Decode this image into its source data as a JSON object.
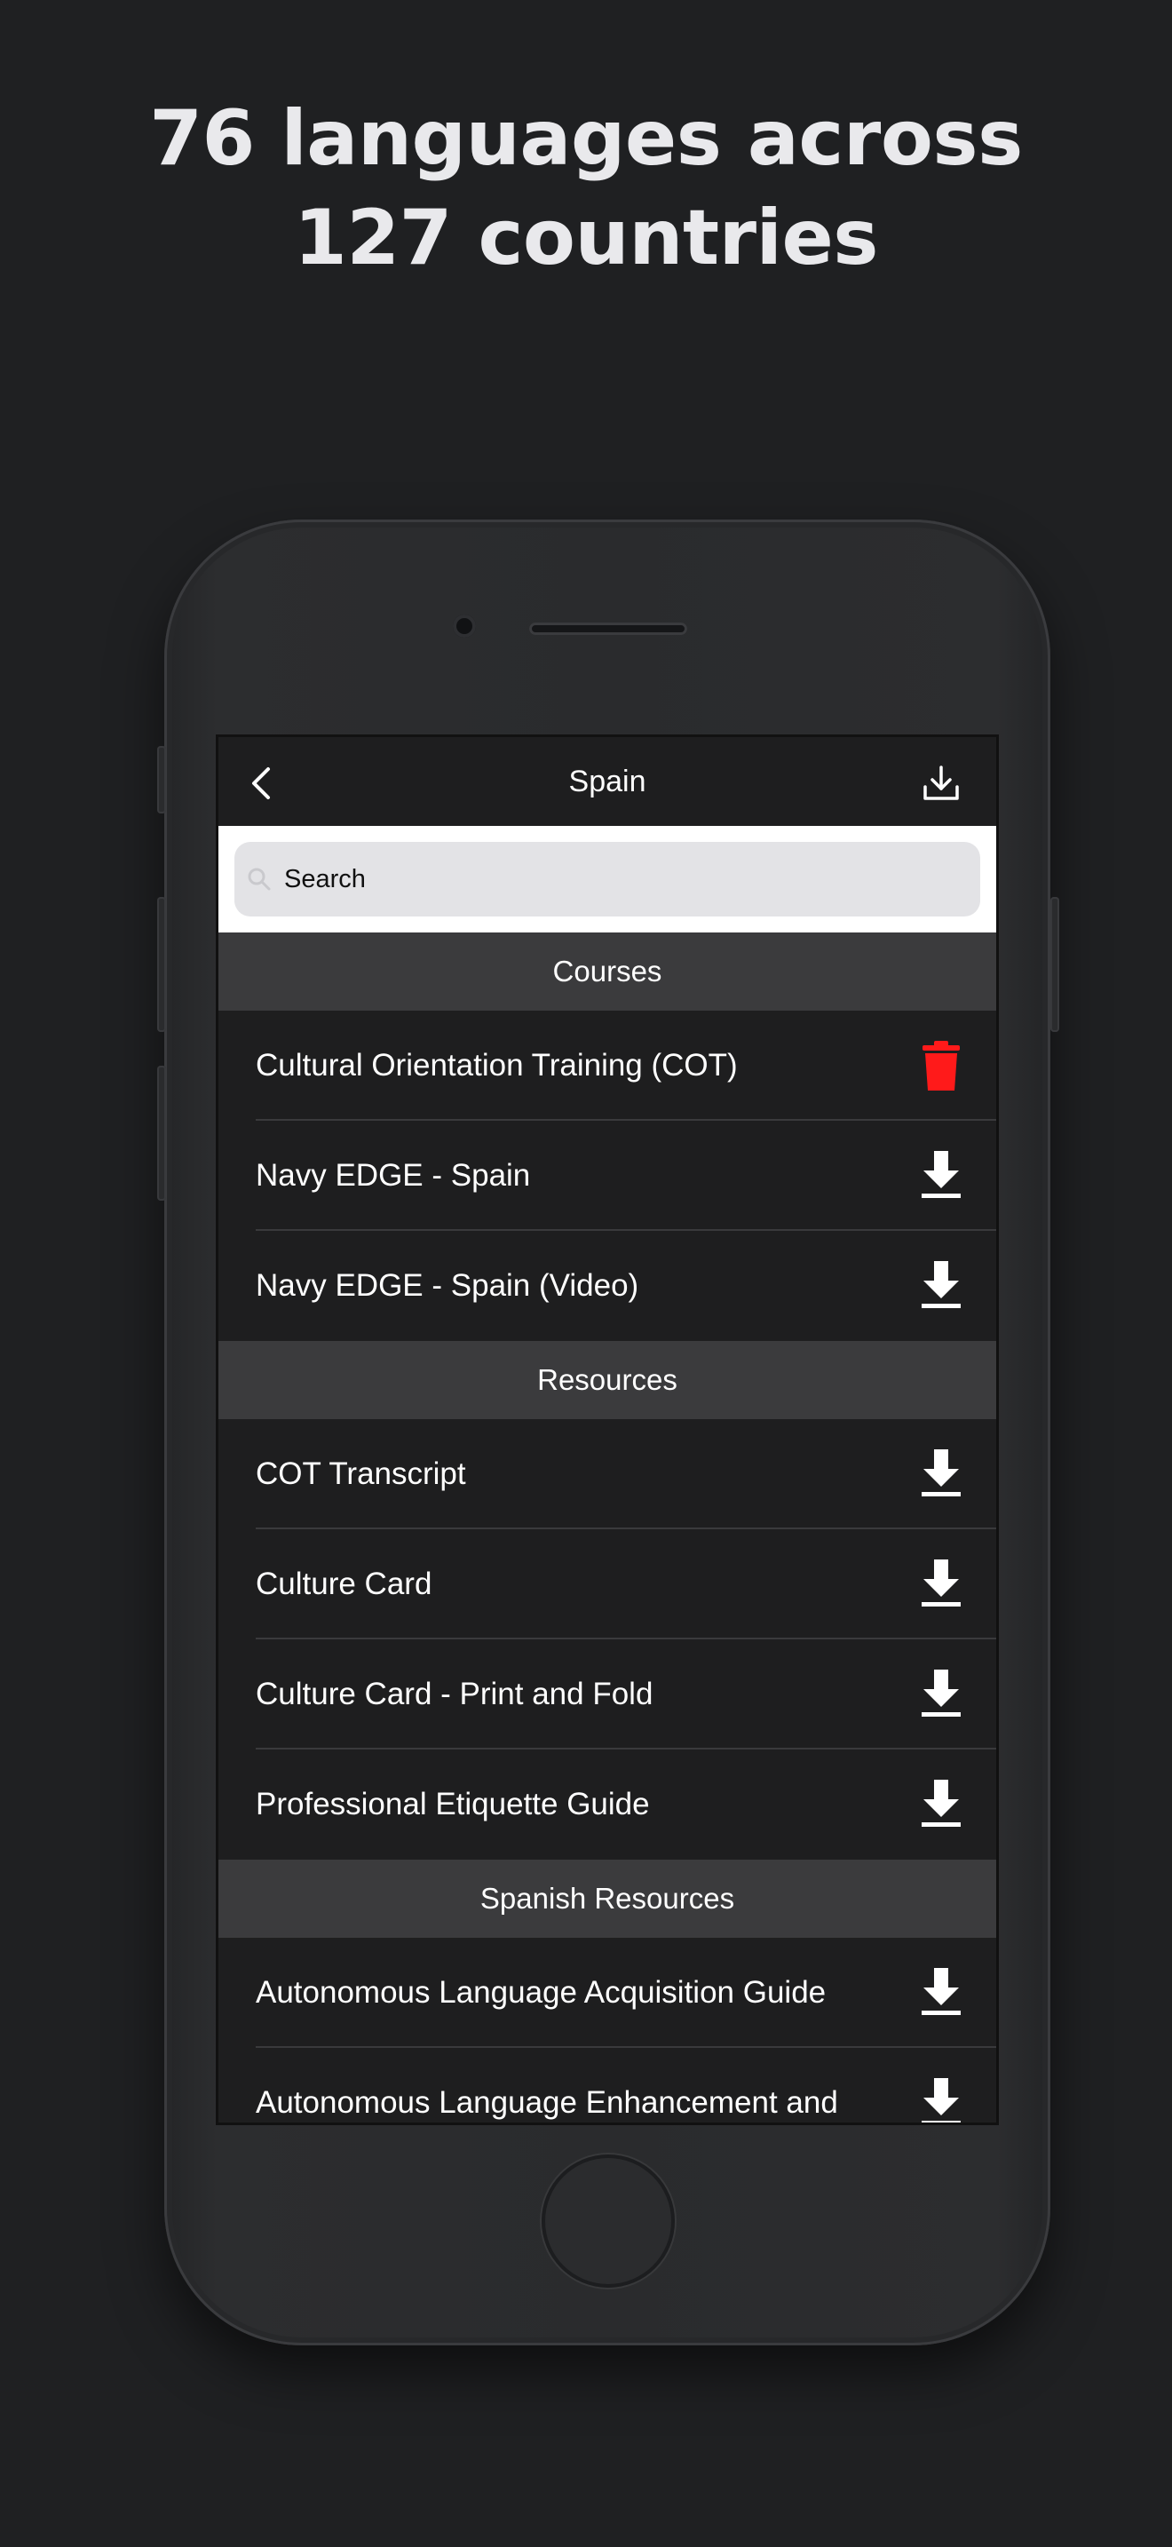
{
  "headline": {
    "line1": "76 languages across",
    "line2": "127 countries"
  },
  "navbar": {
    "title": "Spain",
    "back_icon": "chevron-left-icon",
    "action_icon": "download-tray-icon"
  },
  "search": {
    "placeholder": "Search"
  },
  "sections": [
    {
      "title": "Courses",
      "items": [
        {
          "label": "Cultural Orientation Training (COT)",
          "icon": "trash-icon",
          "icon_color": "#ff1a1a"
        },
        {
          "label": "Navy EDGE - Spain",
          "icon": "download-icon"
        },
        {
          "label": "Navy EDGE - Spain (Video)",
          "icon": "download-icon"
        }
      ]
    },
    {
      "title": "Resources",
      "items": [
        {
          "label": "COT Transcript",
          "icon": "download-icon"
        },
        {
          "label": "Culture Card",
          "icon": "download-icon"
        },
        {
          "label": "Culture Card - Print and Fold",
          "icon": "download-icon"
        },
        {
          "label": "Professional Etiquette Guide",
          "icon": "download-icon"
        }
      ]
    },
    {
      "title": "Spanish Resources",
      "items": [
        {
          "label": "Autonomous Language Acquisition Guide",
          "icon": "download-icon"
        },
        {
          "label": "Autonomous Language Enhancement and",
          "icon": "download-icon"
        }
      ]
    }
  ],
  "colors": {
    "background": "#1f2022",
    "delete": "#ff1a1a",
    "section_header": "#3b3b3d"
  }
}
